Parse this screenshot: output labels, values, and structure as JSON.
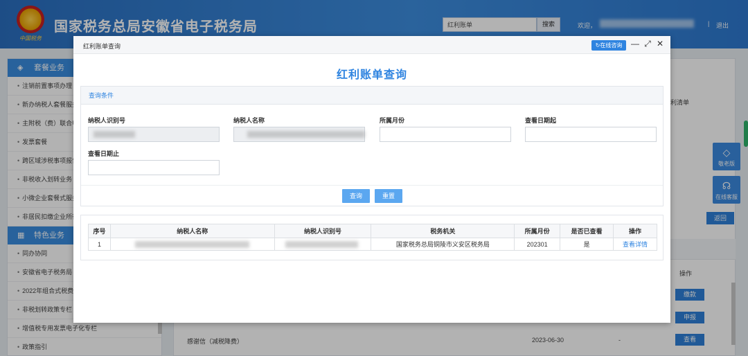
{
  "header": {
    "site_title": "国家税务总局安徽省电子税务局",
    "emblem_text": "中国税务",
    "search_value": "红利账单",
    "search_button": "搜索",
    "welcome": "欢迎，",
    "separator": "|",
    "logout": "退出"
  },
  "sidebar": {
    "section1": "套餐业务",
    "items1": [
      "注销前置事项办理",
      "新办纳税人套餐服务",
      "主附税（费）联合申报",
      "发票套餐",
      "跨区域涉税事项报告",
      "非税收入划转业务",
      "小微企业套餐式服务",
      "非居民扣缴企业所得税"
    ],
    "section2": "特色业务",
    "items2": [
      "同办协同",
      "安徽省电子税务局",
      "2022年组合式税费支持",
      "非税划转政策专栏",
      "增值税专用发票电子化专栏",
      "政策指引"
    ]
  },
  "background": {
    "hongli_text": "利清单",
    "return_button": "返回",
    "op_header": "操作",
    "btn_pay": "缴款",
    "btn_declare": "申报",
    "btn_view": "查看",
    "row_name": "感谢信（减税降费）",
    "row_date": "2023-06-30",
    "row_dash": "-"
  },
  "float": {
    "elder": "敬老版",
    "service": "在线客服"
  },
  "modal": {
    "title": "红利账单查询",
    "online_button": "在线咨询",
    "heading": "红利账单查询",
    "query_section_title": "查询条件",
    "fields": {
      "taxpayer_id_label": "纳税人识别号",
      "taxpayer_name_label": "纳税人名称",
      "month_label": "所属月份",
      "view_date_start_label": "查看日期起",
      "view_date_end_label": "查看日期止"
    },
    "query_button": "查询",
    "reset_button": "重置",
    "table": {
      "columns": [
        "序号",
        "纳税人名称",
        "纳税人识别号",
        "税务机关",
        "所属月份",
        "是否已查看",
        "操作"
      ],
      "rows": [
        {
          "index": "1",
          "tax_authority": "国家税务总局铜陵市义安区税务局",
          "month": "202301",
          "viewed": "是",
          "action": "查看详情"
        }
      ]
    }
  }
}
